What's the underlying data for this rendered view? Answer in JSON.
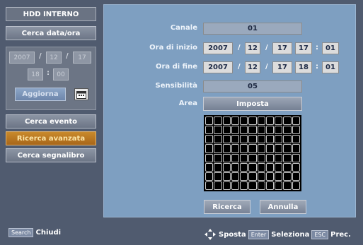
{
  "sidebar": {
    "title": "HDD INTERNO",
    "search_date_label": "Cerca data/ora",
    "date": {
      "year": "2007",
      "month": "12",
      "day": "17",
      "hour": "18",
      "minute": "00"
    },
    "update_label": "Aggiorna",
    "menu": [
      {
        "label": "Cerca evento"
      },
      {
        "label": "Ricerca avanzata"
      },
      {
        "label": "Cerca segnalibro"
      }
    ]
  },
  "form": {
    "channel_label": "Canale",
    "channel_value": "01",
    "start_label": "Ora di inizio",
    "start": {
      "year": "2007",
      "month": "12",
      "day": "17",
      "hour": "17",
      "minute": "01"
    },
    "end_label": "Ora di fine",
    "end": {
      "year": "2007",
      "month": "12",
      "day": "17",
      "hour": "18",
      "minute": "01"
    },
    "sensitivity_label": "Sensibilità",
    "sensitivity_value": "05",
    "area_label": "Area",
    "set_label": "Imposta",
    "search_label": "Ricerca",
    "cancel_label": "Annulla"
  },
  "footer": {
    "search_key": "Search",
    "close_label": "Chiudi",
    "move_label": "Sposta",
    "enter_key": "Enter",
    "select_label": "Seleziona",
    "esc_key": "ESC",
    "prev_label": "Prec."
  },
  "colors": {
    "background": "#505b6f",
    "panel": "#7e9fc1",
    "active_item": "#c98a2c"
  }
}
